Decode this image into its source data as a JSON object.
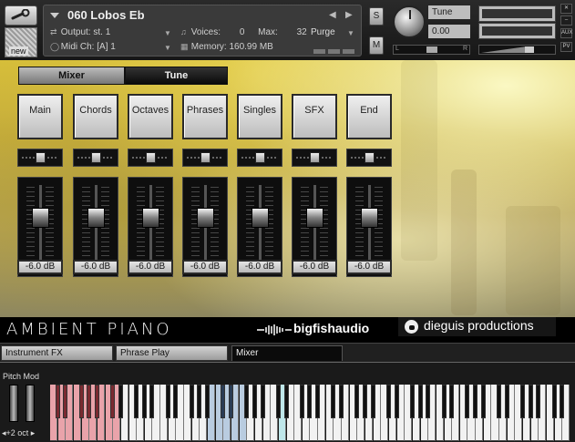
{
  "header": {
    "instrument_name": "060 Lobos Eb",
    "output_label": "Output:",
    "output_value": "st. 1",
    "voices_label": "Voices:",
    "voices_value": "0",
    "max_label": "Max:",
    "max_value": "32",
    "purge_label": "Purge",
    "midi_label": "Midi Ch:",
    "midi_value": "[A] 1",
    "memory_label": "Memory:",
    "memory_value": "160.99 MB",
    "new_label": "new",
    "solo_label": "S",
    "mute_label": "M",
    "tune_label": "Tune",
    "tune_value": "0.00",
    "pan_left": "L",
    "pan_right": "R",
    "aux_label": "AUX",
    "pv_label": "PV"
  },
  "panel_tabs": {
    "mixer": "Mixer",
    "tune": "Tune"
  },
  "channels": [
    {
      "name": "Main",
      "level": "-6.0 dB"
    },
    {
      "name": "Chords",
      "level": "-6.0 dB"
    },
    {
      "name": "Octaves",
      "level": "-6.0 dB"
    },
    {
      "name": "Phrases",
      "level": "-6.0 dB"
    },
    {
      "name": "Singles",
      "level": "-6.0 dB"
    },
    {
      "name": "SFX",
      "level": "-6.0 dB"
    },
    {
      "name": "End",
      "level": "-6.0 dB"
    }
  ],
  "branding": {
    "product": "AMBIENT PIANO",
    "publisher": "bigfishaudio",
    "developer": "dieguis productions"
  },
  "bottom_tabs": {
    "instrument_fx": "Instrument FX",
    "phrase_play": "Phrase Play",
    "mixer": "Mixer"
  },
  "keyboard": {
    "pitch_mod_label": "Pitch Mod",
    "octave_label": "◂+2 oct ▸",
    "colors": {
      "red": "#e9a3aa",
      "blue": "#b9cce0",
      "cyan": "#bfe7ea",
      "white": "#f2f2f2"
    }
  },
  "colors": {
    "accent_yellow": "#d6be3a",
    "panel_dark": "#1a1a1a"
  }
}
